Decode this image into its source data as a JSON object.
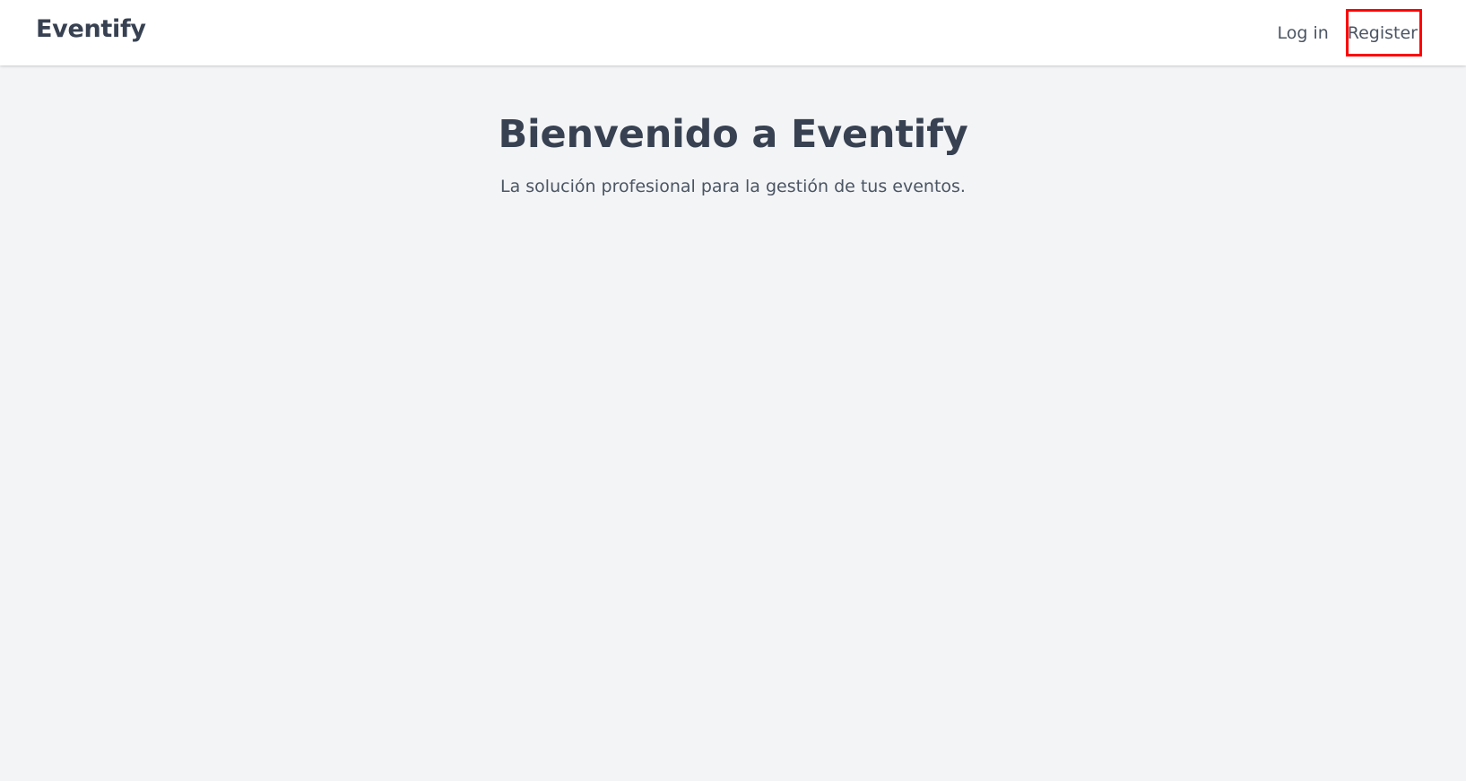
{
  "header": {
    "brand": "Eventify",
    "nav": {
      "login_label": "Log in",
      "register_label": "Register"
    }
  },
  "hero": {
    "title": "Bienvenido a Eventify",
    "subtitle": "La solución profesional para la gestión de tus eventos."
  },
  "colors": {
    "page_background": "#f3f4f6",
    "header_background": "#ffffff",
    "text_primary": "#374151",
    "text_secondary": "#4b5563",
    "highlight": "#ff0000"
  }
}
